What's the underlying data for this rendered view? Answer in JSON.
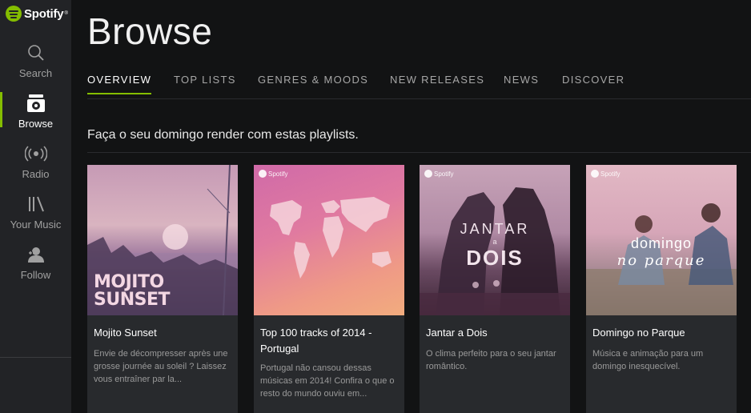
{
  "brand": {
    "name": "Spotify",
    "accent": "#84bd00"
  },
  "sidebar": {
    "items": [
      {
        "label": "Search",
        "icon": "search-icon"
      },
      {
        "label": "Browse",
        "icon": "browse-icon",
        "active": true
      },
      {
        "label": "Radio",
        "icon": "radio-icon"
      },
      {
        "label": "Your Music",
        "icon": "library-icon"
      },
      {
        "label": "Follow",
        "icon": "follow-icon"
      }
    ]
  },
  "header": {
    "title": "Browse"
  },
  "tabs": [
    {
      "label": "OVERVIEW",
      "active": true
    },
    {
      "label": "TOP LISTS"
    },
    {
      "label": "GENRES & MOODS"
    },
    {
      "label": "NEW RELEASES"
    },
    {
      "label": "NEWS"
    },
    {
      "label": "DISCOVER"
    }
  ],
  "section": {
    "title": "Faça o seu domingo render com estas playlists."
  },
  "playlists": [
    {
      "title": "Mojito Sunset",
      "art_text": [
        "MOJITO",
        "SUNSET"
      ],
      "description": "Envie de décompresser après une grosse journée au soleil ? Laissez vous entraîner par la..."
    },
    {
      "title": "Top 100 tracks of 2014 - Portugal",
      "badge": "Spotify",
      "description": "Portugal não cansou dessas músicas em 2014! Confira o que o resto do mundo ouviu em..."
    },
    {
      "title": "Jantar a Dois",
      "badge": "Spotify",
      "art_text": [
        "JANTAR",
        "a",
        "DOIS"
      ],
      "description": "O clima perfeito para o seu jantar romântico."
    },
    {
      "title": "Domingo no Parque",
      "badge": "Spotify",
      "art_text": [
        "domingo",
        "no parque"
      ],
      "description": "Música e animação para um domingo inesquecível."
    }
  ]
}
